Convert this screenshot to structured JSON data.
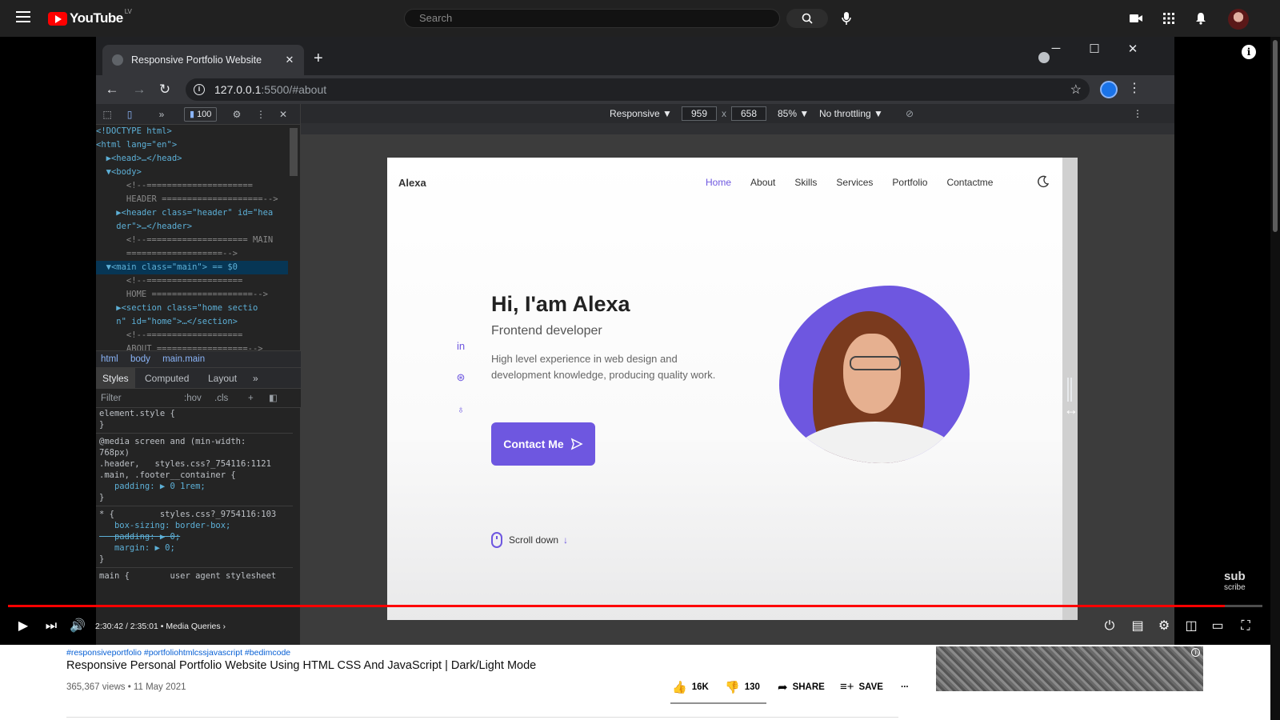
{
  "youtube": {
    "logo_text": "YouTube",
    "logo_country": "LV",
    "search_placeholder": "Search"
  },
  "browser": {
    "tab_title": "Responsive Portfolio Website",
    "url_host": "127.0.0.1",
    "url_rest": ":5500/#about"
  },
  "devtools": {
    "issues_count": "100",
    "dom_lines": [
      "<!DOCTYPE html>",
      "<html lang=\"en\">",
      "  ▶<head>…</head>",
      "  ▼<body>",
      "      <!--=====================",
      "      HEADER ====================-->",
      "    ▶<header class=\"header\" id=\"hea",
      "    der\">…</header>",
      "      <!--==================== MAIN",
      "      ===================-->",
      "  ▼<main class=\"main\"> == $0",
      "      <!--===================",
      "      HOME ====================-->",
      "    ▶<section class=\"home sectio",
      "    n\" id=\"home\">…</section>",
      "      <!--===================",
      "      ABOUT ==================-->"
    ],
    "breadcrumbs": [
      "html",
      "body",
      "main.main"
    ],
    "panel_tabs": [
      "Styles",
      "Computed",
      "Layout"
    ],
    "filter_placeholder": "Filter",
    "filter_hov": ":hov",
    "filter_cls": ".cls",
    "styles_lines": [
      "element.style {",
      "}",
      "@media screen and (min-width:",
      "768px)",
      ".header,   styles.css?_754116:1121",
      ".main, .footer__container {",
      "   padding: ▶ 0 1rem;",
      "}",
      "* {         styles.css?_9754116:103",
      "   box-sizing: border-box;",
      "   padding: ▶ 0;",
      "   margin: ▶ 0;",
      "}",
      "main {        user agent stylesheet"
    ]
  },
  "device_bar": {
    "mode": "Responsive ▼",
    "width": "959",
    "height": "658",
    "times": "x",
    "zoom": "85% ▼",
    "throttle": "No throttling ▼"
  },
  "site": {
    "logo": "Alexa",
    "nav": [
      "Home",
      "About",
      "Skills",
      "Services",
      "Portfolio",
      "Contactme"
    ],
    "hero_title": "Hi, I'am Alexa",
    "hero_subtitle": "Frontend developer",
    "hero_description": "High level experience in web design and development knowledge, producing quality work.",
    "contact_button": "Contact Me",
    "scroll_down": "Scroll down"
  },
  "player": {
    "time": "2:30:42 / 2:35:01",
    "chapter": "Media Queries",
    "progress_fraction": 0.97,
    "watermark_top": "sub",
    "watermark_bottom": "scribe"
  },
  "video": {
    "tags": "#responsiveportfolio #portfoliohtmlcssjavascript #bedimcode",
    "title": "Responsive Personal Portfolio Website Using HTML CSS And JavaScript | Dark/Light Mode",
    "views": "365,367 views • 11 May 2021",
    "likes": "16K",
    "dislikes": "130",
    "share": "SHARE",
    "save": "SAVE",
    "more": "..."
  },
  "colors": {
    "accent": "#6e57e0",
    "youtube_red": "#ff0000"
  }
}
